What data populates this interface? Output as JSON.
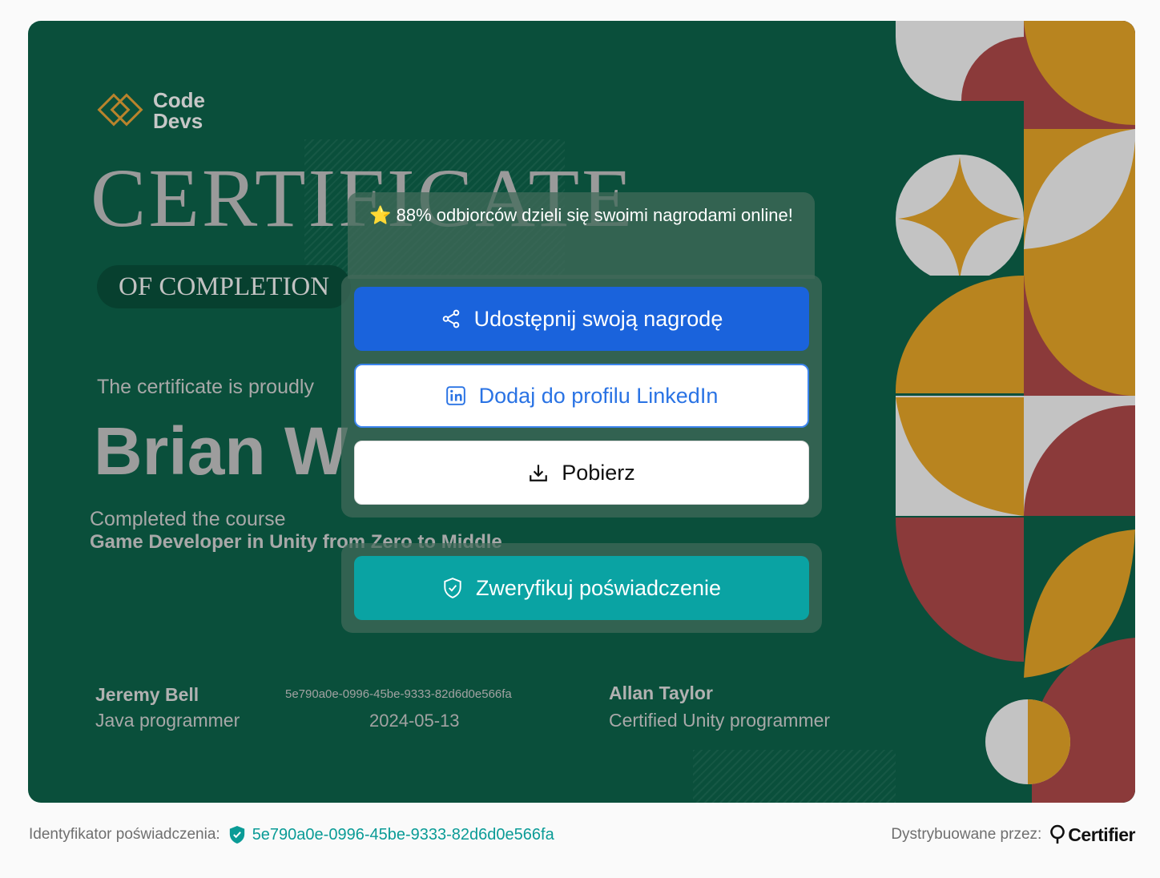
{
  "certificate": {
    "logo": {
      "line1": "Code",
      "line2": "Devs",
      "icon": "double-diamond-logo"
    },
    "title": "CERTIFICATE",
    "subtitle": "OF COMPLETION",
    "presented_text": "The certificate is proudly",
    "recipient": "Brian W",
    "course_prefix": "Completed the course",
    "course_name": "Game Developer in Unity from Zero to Middle",
    "signatory_left": {
      "name": "Jeremy Bell",
      "role": "Java programmer"
    },
    "credential_id": "5e790a0e-0996-45be-9333-82d6d0e566fa",
    "date": "2024-05-13",
    "signatory_right": {
      "name": "Allan Taylor",
      "role": "Certified Unity programmer"
    }
  },
  "overlay": {
    "banner_star": "⭐",
    "banner_text": "88% odbiorców dzieli się swoimi nagrodami online!",
    "share_label": "Udostępnij swoją nagrodę",
    "linkedin_label": "Dodaj do profilu LinkedIn",
    "download_label": "Pobierz",
    "verify_label": "Zweryfikuj poświadczenie"
  },
  "footer": {
    "id_label": "Identyfikator poświadczenia:",
    "id_value": "5e790a0e-0996-45be-9333-82d6d0e566fa",
    "distributed_label": "Dystrybuowane przez:",
    "brand": "Certifier"
  },
  "colors": {
    "certificate_bg": "#0a4f3b",
    "share_button": "#1a63dc",
    "linkedin_text": "#2a73e4",
    "verify_button": "#0aa3a3",
    "pattern_gray": "#c3c3c3",
    "pattern_red": "#8b3a3a",
    "pattern_gold": "#b8841f"
  },
  "icons": [
    "share-icon",
    "linkedin-icon",
    "download-icon",
    "shield-check-icon",
    "verified-shield-icon",
    "certifier-logo-icon"
  ]
}
